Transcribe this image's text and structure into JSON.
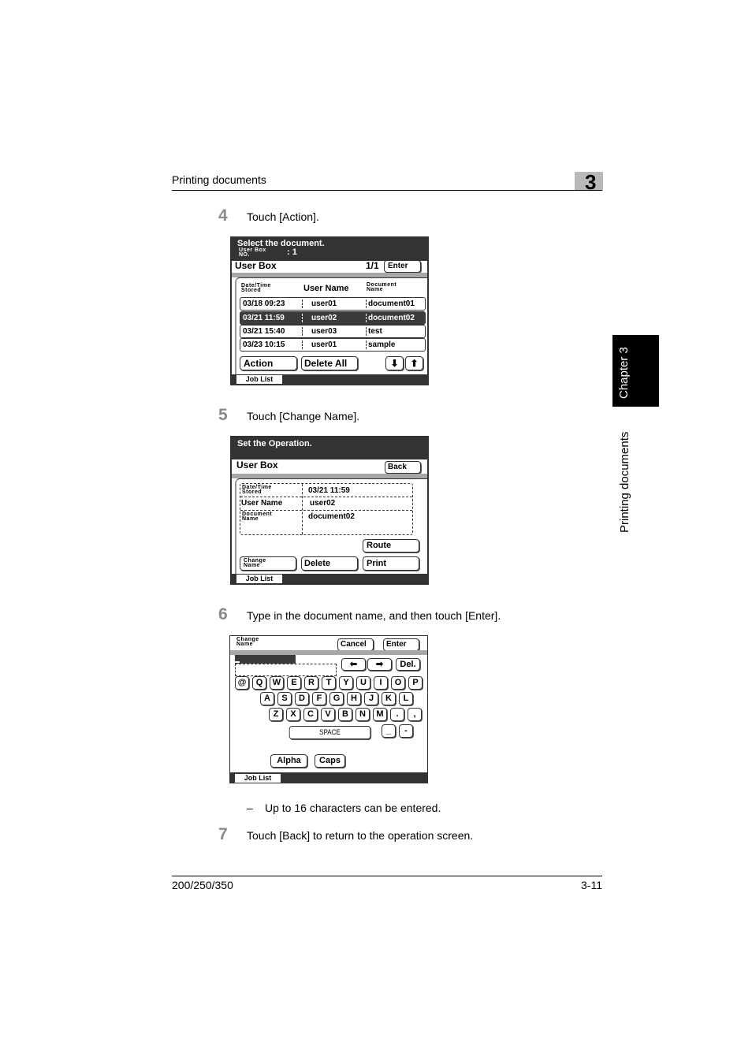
{
  "header": {
    "section_title": "Printing documents",
    "chapter_number": "3"
  },
  "side_tab": {
    "chapter_label": "Chapter 3",
    "section_label": "Printing documents"
  },
  "footer": {
    "model": "200/250/350",
    "page": "3-11"
  },
  "steps": [
    {
      "number": "4",
      "text": "Touch [Action]."
    },
    {
      "number": "5",
      "text": "Touch [Change Name]."
    },
    {
      "number": "6",
      "text": "Type in the document name, and then touch [Enter]."
    },
    {
      "number": "7",
      "text": "Touch [Back] to return to the operation screen."
    }
  ],
  "note": {
    "dash": "–",
    "text": "Up to 16 characters can be entered."
  },
  "screen1": {
    "title": "Select the document.",
    "userbox_no_label_1": "User Box",
    "userbox_no_label_2": "NO.",
    "userbox_no_value": ": 1",
    "box_label": "User Box",
    "page_indicator": "1/1",
    "enter_button": "Enter",
    "col_date_1": "Date/Time",
    "col_date_2": "Stored",
    "col_user": "User Name",
    "col_doc_1": "Document",
    "col_doc_2": "Name",
    "rows": [
      {
        "date": "03/18 09:23",
        "user": "user01",
        "doc": "document01",
        "selected": false
      },
      {
        "date": "03/21 11:59",
        "user": "user02",
        "doc": "document02",
        "selected": true
      },
      {
        "date": "03/21 15:40",
        "user": "user03",
        "doc": "test",
        "selected": false
      },
      {
        "date": "03/23 10:15",
        "user": "user01",
        "doc": "sample",
        "selected": false
      }
    ],
    "action_button": "Action",
    "delete_all_button": "Delete All",
    "down_arrow": "⬇",
    "up_arrow": "⬆",
    "job_list": "Job List"
  },
  "screen2": {
    "title": "Set the Operation.",
    "box_label": "User Box",
    "back_button": "Back",
    "date_label_1": "Date/Time",
    "date_label_2": "Stored",
    "date_value": "03/21  11:59",
    "user_label": "User Name",
    "user_value": "user02",
    "doc_label_1": "Document",
    "doc_label_2": "Name",
    "doc_value": "document02",
    "route_button": "Route",
    "change_name_1": "Change",
    "change_name_2": "Name",
    "delete_button": "Delete",
    "print_button": "Print",
    "job_list": "Job List"
  },
  "screen3": {
    "title_1": "Change",
    "title_2": "Name",
    "cancel_button": "Cancel",
    "enter_button": "Enter",
    "input_value": "",
    "left_arrow": "⬅",
    "right_arrow": "➡",
    "del_button": "Del.",
    "row1": [
      "@",
      "Q",
      "W",
      "E",
      "R",
      "T",
      "Y",
      "U",
      "I",
      "O",
      "P"
    ],
    "row2": [
      "A",
      "S",
      "D",
      "F",
      "G",
      "H",
      "J",
      "K",
      "L"
    ],
    "row3": [
      "Z",
      "X",
      "C",
      "V",
      "B",
      "N",
      "M",
      ".",
      ","
    ],
    "space_button": "SPACE",
    "underscore_key": "_",
    "hyphen_key": "-",
    "alpha_button": "Alpha",
    "caps_button": "Caps",
    "job_list": "Job List"
  }
}
